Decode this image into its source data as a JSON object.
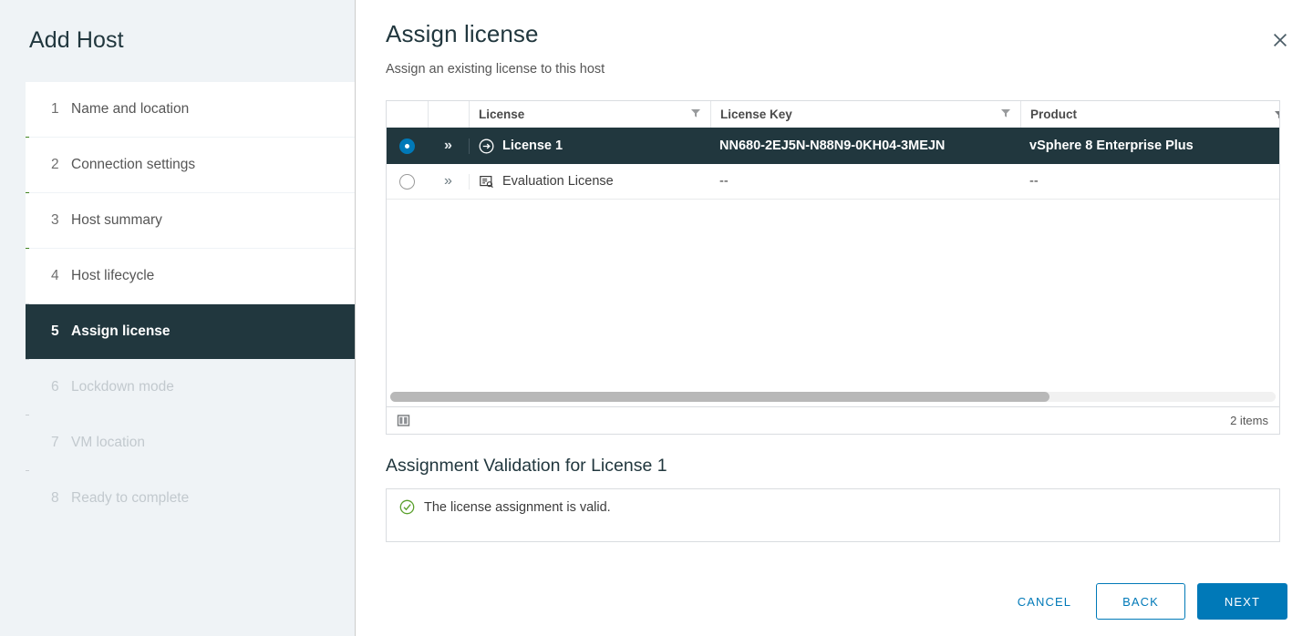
{
  "sidebar": {
    "title": "Add Host",
    "items": [
      {
        "num": "1",
        "label": "Name and location",
        "state": "done"
      },
      {
        "num": "2",
        "label": "Connection settings",
        "state": "done"
      },
      {
        "num": "3",
        "label": "Host summary",
        "state": "done"
      },
      {
        "num": "4",
        "label": "Host lifecycle",
        "state": "done"
      },
      {
        "num": "5",
        "label": "Assign license",
        "state": "active"
      },
      {
        "num": "6",
        "label": "Lockdown mode",
        "state": "pending"
      },
      {
        "num": "7",
        "label": "VM location",
        "state": "pending"
      },
      {
        "num": "8",
        "label": "Ready to complete",
        "state": "pending"
      }
    ],
    "rail_done_color": "#408420",
    "rail_todo_color": "#c9ced2",
    "active_bg": "#21373e"
  },
  "header": {
    "title": "Assign license",
    "subtitle": "Assign an existing license to this host",
    "close_icon": "close-icon"
  },
  "grid": {
    "columns": [
      {
        "key": "select",
        "label": "",
        "filter": false
      },
      {
        "key": "expand",
        "label": "",
        "filter": false
      },
      {
        "key": "license",
        "label": "License",
        "filter": true
      },
      {
        "key": "license_key",
        "label": "License Key",
        "filter": true
      },
      {
        "key": "product",
        "label": "Product",
        "filter": true
      }
    ],
    "rows": [
      {
        "selected": true,
        "icon": "arrow-right-circle-icon",
        "license": "License 1",
        "license_key": "NN680-2EJ5N-N88N9-0KH04-3MEJN",
        "product": "vSphere 8 Enterprise Plus"
      },
      {
        "selected": false,
        "icon": "license-document-icon",
        "license": "Evaluation License",
        "license_key": "--",
        "product": "--"
      }
    ],
    "footer": {
      "column_picker_icon": "column-picker-icon",
      "item_count": "2 items"
    },
    "scrollbar": {
      "thumb_fraction_percent": 74.5
    }
  },
  "validation": {
    "title": "Assignment Validation for License 1",
    "status_icon": "check-circle-icon",
    "status_color": "#5aa02c",
    "message": "The license assignment is valid."
  },
  "footer": {
    "cancel_label": "CANCEL",
    "back_label": "BACK",
    "next_label": "NEXT",
    "accent_color": "#0079b8"
  }
}
